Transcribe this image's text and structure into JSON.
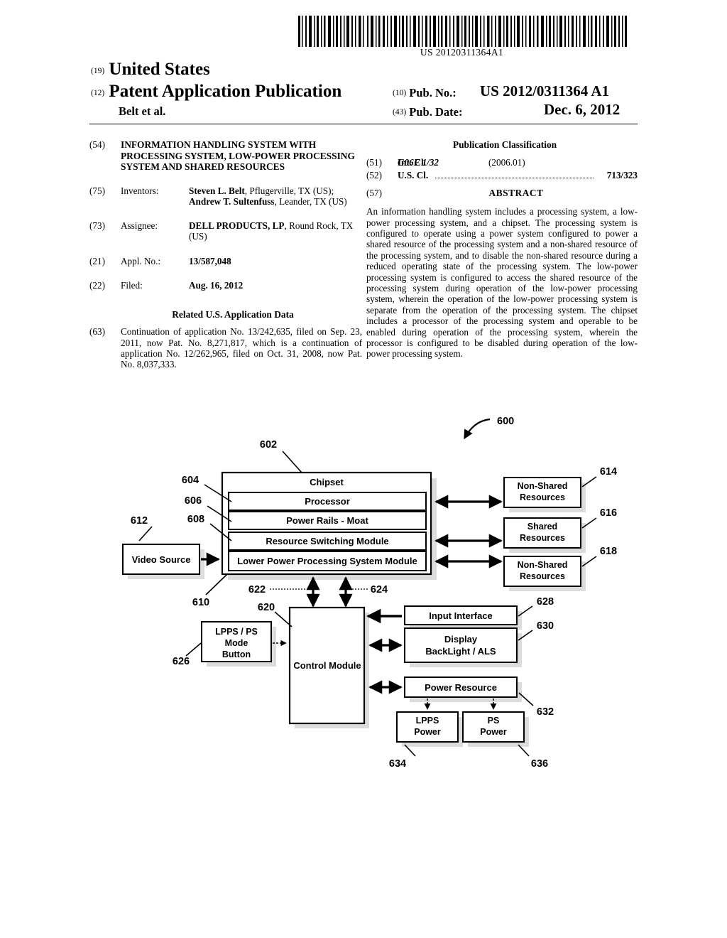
{
  "barcode": {
    "number": "US 20120311364A1"
  },
  "header": {
    "code_19": "(19)",
    "country": "United States",
    "code_12": "(12)",
    "doc_type": "Patent Application Publication",
    "authors": "Belt et al.",
    "code_10": "(10)",
    "pubno_label": "Pub. No.:",
    "pubno_value": "US 2012/0311364 A1",
    "code_43": "(43)",
    "pubdate_label": "Pub. Date:",
    "pubdate_value": "Dec. 6, 2012"
  },
  "left_column": {
    "title": {
      "code": "(54)",
      "text": "INFORMATION HANDLING SYSTEM WITH PROCESSING SYSTEM, LOW-POWER PROCESSING SYSTEM AND SHARED RESOURCES"
    },
    "inventors": {
      "code": "(75)",
      "label": "Inventors:",
      "name1": "Steven L. Belt",
      "loc1": ", Pflugerville, TX (US); ",
      "name2": "Andrew T. Sultenfuss",
      "loc2": ", Leander, TX (US)"
    },
    "assignee": {
      "code": "(73)",
      "label": "Assignee:",
      "name": "DELL PRODUCTS, LP",
      "loc": ", Round Rock, TX (US)"
    },
    "appl_no": {
      "code": "(21)",
      "label": "Appl. No.:",
      "value": "13/587,048"
    },
    "filed": {
      "code": "(22)",
      "label": "Filed:",
      "value": "Aug. 16, 2012"
    },
    "related": {
      "heading": "Related U.S. Application Data",
      "code": "(63)",
      "text": "Continuation of application No. 13/242,635, filed on Sep. 23, 2011, now Pat. No. 8,271,817, which is a continuation of application No. 12/262,965, filed on Oct. 31, 2008, now Pat. No. 8,037,333."
    }
  },
  "right_column": {
    "pub_class_heading": "Publication Classification",
    "int_cl": {
      "code": "(51)",
      "label": "Int. Cl.",
      "classification": "G06F 1/32",
      "year": "(2006.01)"
    },
    "us_cl": {
      "code": "(52)",
      "label": "U.S. Cl.",
      "value": "713/323"
    },
    "abstract": {
      "code": "(57)",
      "heading": "ABSTRACT",
      "text": "An information handling system includes a processing system, a low-power processing system, and a chipset. The processing system is configured to operate using a power system configured to power a shared resource of the processing system and a non-shared resource of the processing system, and to disable the non-shared resource during a reduced operating state of the processing system. The low-power processing system is configured to access the shared resource of the processing system during operation of the low-power processing system, wherein the operation of the low-power processing system is separate from the operation of the processing system. The chipset includes a processor of the processing system and operable to be enabled during operation of the processing system, wherein the processor is configured to be disabled during operation of the low-power processing system."
    }
  },
  "figure": {
    "fig_ref": "600",
    "blocks": {
      "chipset": {
        "label": "Chipset",
        "ref": "602"
      },
      "processor": {
        "label": "Processor",
        "ref": "604"
      },
      "power_rails": {
        "label": "Power Rails - Moat",
        "ref": "606"
      },
      "resource_switching": {
        "label": "Resource Switching Module",
        "ref": "608"
      },
      "lpps_module": {
        "label": "Lower Power Processing System Module",
        "ref": "610"
      },
      "video_source": {
        "label": "Video Source",
        "ref": "612"
      },
      "non_shared_1": {
        "label_line1": "Non-Shared",
        "label_line2": "Resources",
        "ref": "614"
      },
      "shared": {
        "label_line1": "Shared",
        "label_line2": "Resources",
        "ref": "616"
      },
      "non_shared_2": {
        "label_line1": "Non-Shared",
        "label_line2": "Resources",
        "ref": "618"
      },
      "control_module": {
        "label": "Control Module",
        "ref": "620"
      },
      "mode_button": {
        "label_line1": "LPPS / PS",
        "label_line2": "Mode",
        "label_line3": "Button",
        "ref": "626"
      },
      "input_interface": {
        "label": "Input Interface",
        "ref": "628"
      },
      "display_backlight": {
        "label_line1": "Display",
        "label_line2": "BackLight / ALS",
        "ref": "630"
      },
      "power_resource": {
        "label": "Power Resource",
        "ref": "632"
      },
      "lpps_power": {
        "label_line1": "LPPS",
        "label_line2": "Power",
        "ref": "634"
      },
      "ps_power": {
        "label_line1": "PS",
        "label_line2": "Power",
        "ref": "636"
      }
    },
    "connector_refs": {
      "left_arrow": "622",
      "right_arrow": "624"
    }
  }
}
